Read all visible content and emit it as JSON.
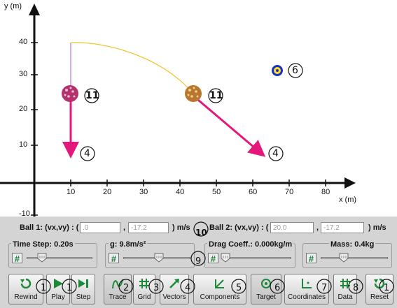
{
  "plot": {
    "y_axis_label": "y (m)",
    "x_axis_label": "x (m)",
    "x_ticks": [
      "10",
      "20",
      "30",
      "40",
      "50",
      "60",
      "70",
      "80"
    ],
    "y_ticks": [
      "40",
      "30",
      "20",
      "10",
      "-10"
    ],
    "ball1_label": "11",
    "ball2_label": "11",
    "target_label": "6",
    "vector1_label": "4",
    "vector2_label": "4",
    "colors": {
      "trajectory": "#f0c430",
      "vector": "#e4187a",
      "target_blue": "#1a2fd0",
      "target_yellow": "#ffe11a",
      "ball1": "#b5316d",
      "ball2": "#b8772c"
    }
  },
  "velocity": {
    "ball1_label": "Ball 1: (vx,vy) : (",
    "ball1_vx": ".0",
    "ball1_vy": "-17.2",
    "ball1_unit": ") m/s",
    "ball2_label": "Ball 2: (vx,vy) : (",
    "ball2_vx": "20.0",
    "ball2_vy": "-17.2",
    "ball2_unit": ") m/s",
    "sep": ",",
    "callout": "10"
  },
  "controls": {
    "time_step": "Time Step: 0.20s",
    "gravity": "g: 9.8m/s²",
    "drag": "Drag Coeff.: 0.000kg/m",
    "mass": "Mass: 0.4kg",
    "hash": "#",
    "callout": "9"
  },
  "buttons": {
    "rewind": "Rewind",
    "play": "Play",
    "step": "Step",
    "trace": "Trace",
    "grid": "Grid",
    "vectors": "Vectors",
    "components": "Components",
    "target": "Target",
    "coordinates": "Coordinates",
    "data": "Data",
    "reset": "Reset"
  },
  "callouts": {
    "rewind": "1",
    "play": "1",
    "step": "1",
    "trace": "2",
    "grid": "3",
    "vectors": "4",
    "components": "5",
    "target": "6",
    "coordinates": "7",
    "data": "8",
    "reset": "1"
  }
}
